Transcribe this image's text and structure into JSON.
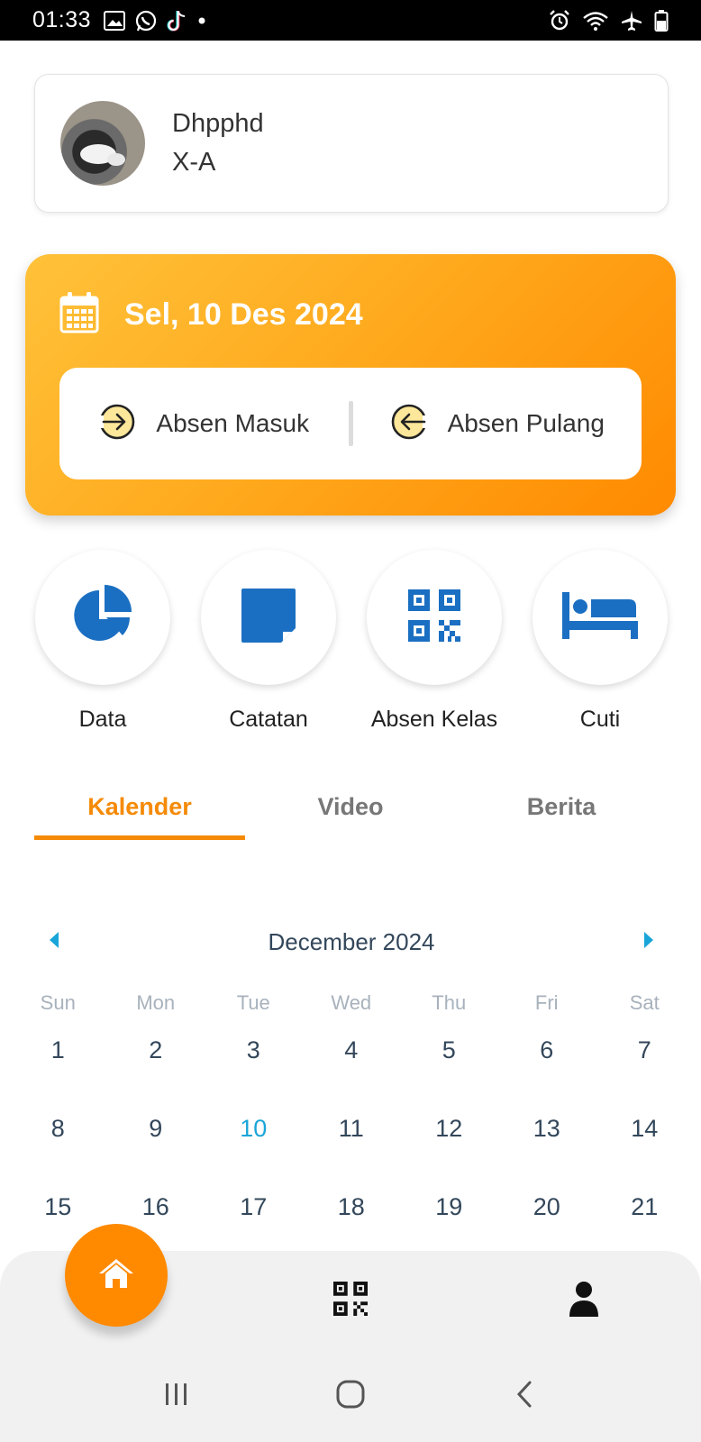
{
  "status_bar": {
    "time": "01:33",
    "left_icons": [
      "gallery-icon",
      "whatsapp-icon",
      "tiktok-icon",
      "dot-icon"
    ],
    "right_icons": [
      "alarm-icon",
      "wifi-icon",
      "airplane-icon",
      "battery-icon"
    ]
  },
  "profile": {
    "name": "Dhpphd",
    "class": "X-A"
  },
  "attendance": {
    "date": "Sel, 10 Des 2024",
    "check_in_label": "Absen Masuk",
    "check_out_label": "Absen Pulang"
  },
  "menu": {
    "items": [
      {
        "label": "Data",
        "icon": "pie-chart-icon"
      },
      {
        "label": "Catatan",
        "icon": "note-icon"
      },
      {
        "label": "Absen Kelas",
        "icon": "qr-code-icon"
      },
      {
        "label": "Cuti",
        "icon": "bed-icon"
      }
    ]
  },
  "tabs": {
    "items": [
      "Kalender",
      "Video",
      "Berita"
    ],
    "active": "Kalender"
  },
  "calendar": {
    "month_title": "December 2024",
    "weekdays": [
      "Sun",
      "Mon",
      "Tue",
      "Wed",
      "Thu",
      "Fri",
      "Sat"
    ],
    "weeks": [
      [
        "1",
        "2",
        "3",
        "4",
        "5",
        "6",
        "7"
      ],
      [
        "8",
        "9",
        "10",
        "11",
        "12",
        "13",
        "14"
      ],
      [
        "15",
        "16",
        "17",
        "18",
        "19",
        "20",
        "21"
      ]
    ],
    "today": "10"
  },
  "bottom_nav": {
    "items": [
      "home-icon",
      "qr-code-icon",
      "person-icon"
    ]
  },
  "colors": {
    "accent": "#ff8a00",
    "menu_icon": "#1b6fc2",
    "calendar_arrow": "#1aa5d8",
    "today": "#1aa5d8"
  }
}
